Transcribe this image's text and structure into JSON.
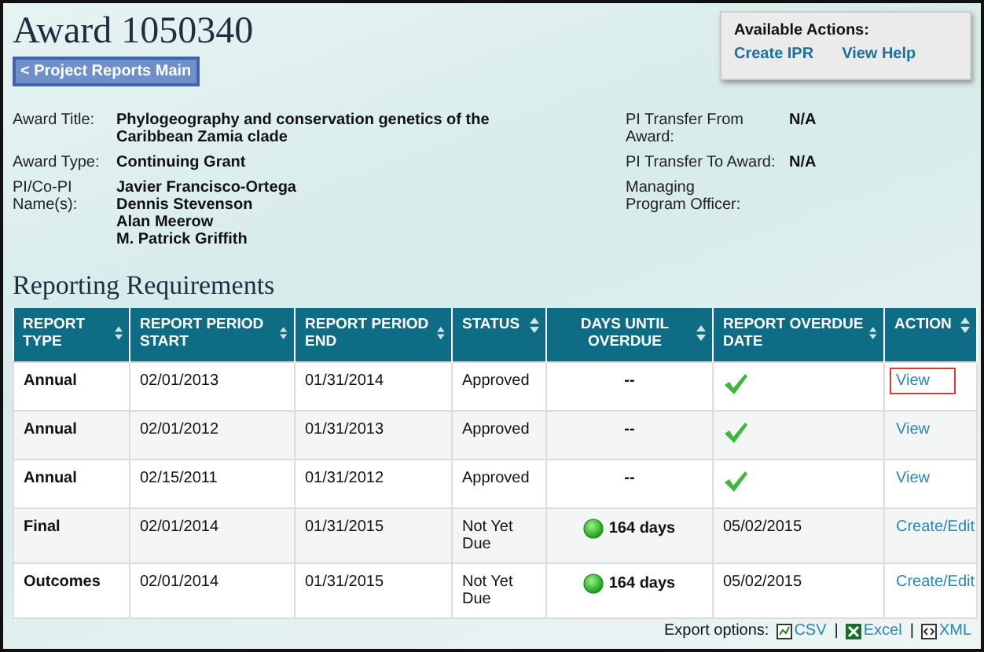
{
  "title": "Award 1050340",
  "back_button": "< Project Reports Main",
  "actions": {
    "heading": "Available Actions:",
    "links": [
      "Create IPR",
      "View Help"
    ]
  },
  "details_left": [
    {
      "label": "Award Title:",
      "values": [
        "Phylogeography and conservation genetics of the Caribbean Zamia clade"
      ]
    },
    {
      "label": "Award Type:",
      "values": [
        "Continuing Grant"
      ]
    },
    {
      "label": "PI/Co-PI Name(s):",
      "values": [
        "Javier Francisco-Ortega",
        "Dennis Stevenson",
        "Alan Meerow",
        "M. Patrick Griffith"
      ]
    }
  ],
  "details_right": [
    {
      "label": "PI Transfer From Award:",
      "value": "N/A"
    },
    {
      "label": "PI Transfer To Award:",
      "value": "N/A"
    },
    {
      "label": "Managing Program Officer:"
    }
  ],
  "section_title": "Reporting Requirements",
  "table": {
    "columns": [
      {
        "label": "REPORT TYPE"
      },
      {
        "label": "REPORT PERIOD START"
      },
      {
        "label": "REPORT PERIOD END"
      },
      {
        "label": "STATUS"
      },
      {
        "label": "DAYS UNTIL OVERDUE"
      },
      {
        "label": "REPORT OVERDUE DATE"
      },
      {
        "label": "ACTION"
      }
    ],
    "rows": [
      {
        "type": "Annual",
        "start": "02/01/2013",
        "end": "01/31/2014",
        "status": "Approved",
        "days": {
          "kind": "none",
          "text": "--"
        },
        "overdue": {
          "kind": "check"
        },
        "action": {
          "text": "View",
          "highlighted": true
        }
      },
      {
        "type": "Annual",
        "start": "02/01/2012",
        "end": "01/31/2013",
        "status": "Approved",
        "days": {
          "kind": "none",
          "text": "--"
        },
        "overdue": {
          "kind": "check"
        },
        "action": {
          "text": "View",
          "highlighted": false
        }
      },
      {
        "type": "Annual",
        "start": "02/15/2011",
        "end": "01/31/2012",
        "status": "Approved",
        "days": {
          "kind": "none",
          "text": "--"
        },
        "overdue": {
          "kind": "check"
        },
        "action": {
          "text": "View",
          "highlighted": false
        }
      },
      {
        "type": "Final",
        "start": "02/01/2014",
        "end": "01/31/2015",
        "status": "Not Yet Due",
        "days": {
          "kind": "ontime",
          "text": "164 days"
        },
        "overdue": {
          "kind": "date",
          "text": "05/02/2015"
        },
        "action": {
          "text": "Create/Edit",
          "highlighted": false
        }
      },
      {
        "type": "Outcomes",
        "start": "02/01/2014",
        "end": "01/31/2015",
        "status": "Not Yet Due",
        "days": {
          "kind": "ontime",
          "text": "164 days"
        },
        "overdue": {
          "kind": "date",
          "text": "05/02/2015"
        },
        "action": {
          "text": "Create/Edit",
          "highlighted": false
        }
      }
    ]
  },
  "export": {
    "label": "Export options:",
    "separator": "|",
    "options": [
      {
        "kind": "csv",
        "text": "CSV"
      },
      {
        "kind": "excel",
        "text": "Excel"
      },
      {
        "kind": "xml",
        "text": "XML"
      }
    ]
  }
}
